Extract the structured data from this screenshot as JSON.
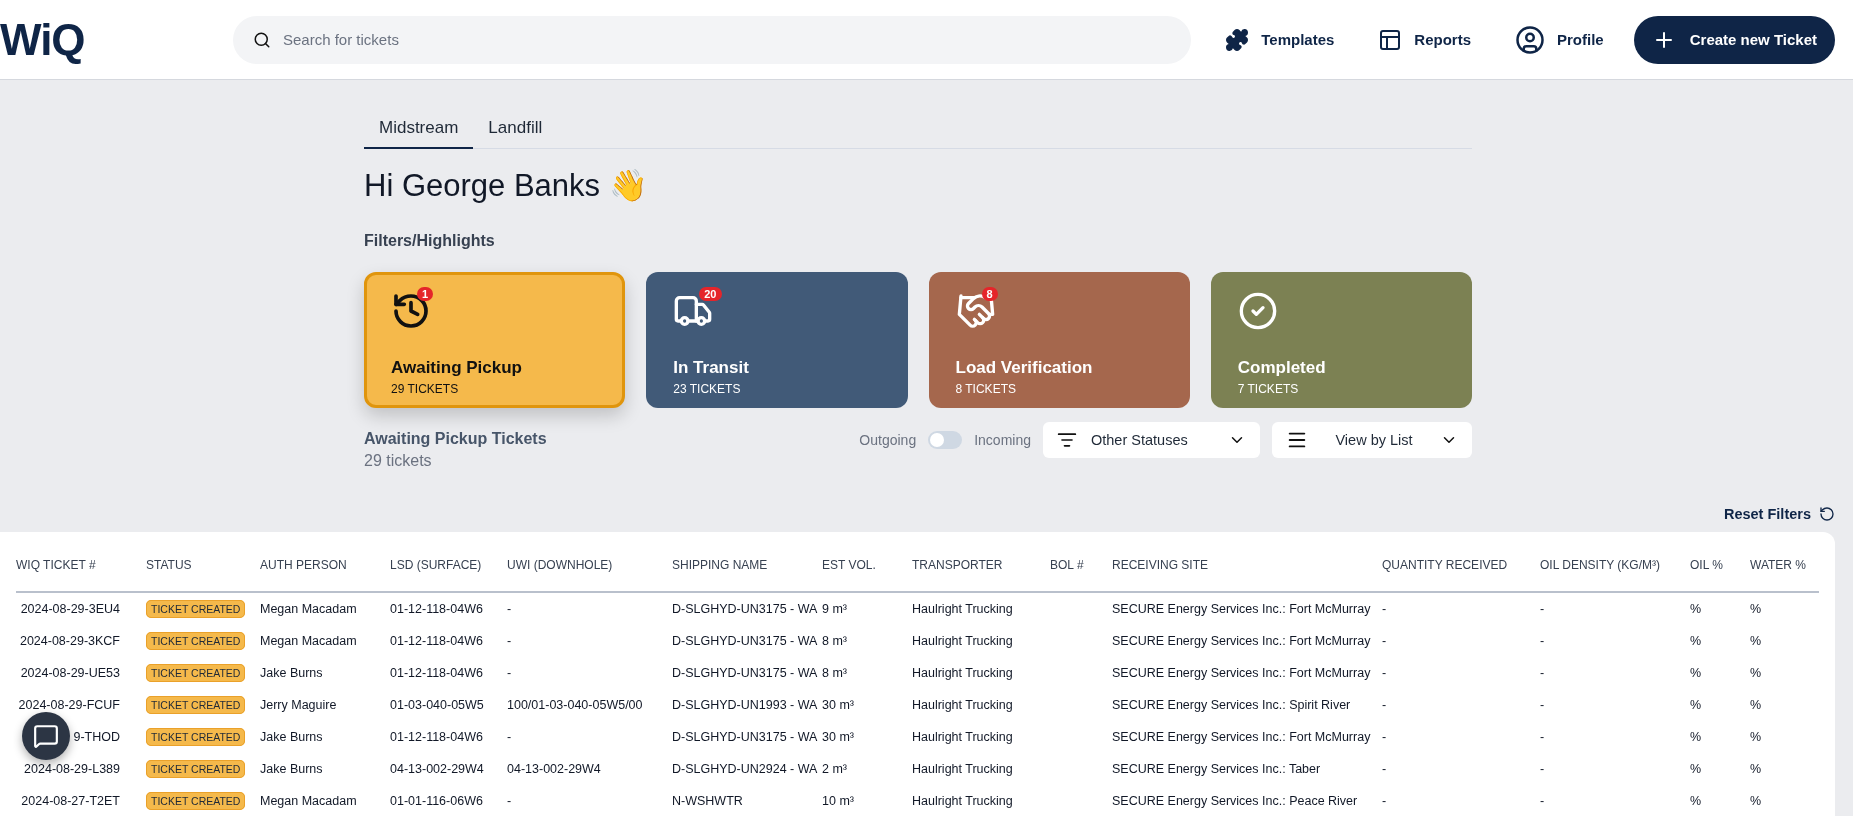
{
  "header": {
    "logo": "WiQ",
    "search": {
      "placeholder": "Search for tickets"
    },
    "nav": [
      {
        "label": "Templates"
      },
      {
        "label": "Reports"
      },
      {
        "label": "Profile"
      }
    ],
    "create_button": "Create new Ticket"
  },
  "tabs": [
    {
      "label": "Midstream",
      "selected": true
    },
    {
      "label": "Landfill",
      "selected": false
    }
  ],
  "greeting": "Hi George Banks 👋",
  "filters_title": "Filters/Highlights",
  "cards": [
    {
      "title": "Awaiting Pickup",
      "count": "29 TICKETS",
      "badge": "1",
      "color": "#f5b94b",
      "selected": true
    },
    {
      "title": "In Transit",
      "count": "23 TICKETS",
      "badge": "20",
      "color": "#415a78",
      "selected": false
    },
    {
      "title": "Load Verification",
      "count": "8 TICKETS",
      "badge": "8",
      "color": "#a5674d",
      "selected": false
    },
    {
      "title": "Completed",
      "count": "7 TICKETS",
      "color": "#7c8153",
      "selected": false
    }
  ],
  "list_title": "Awaiting Pickup Tickets",
  "list_count": "29 tickets",
  "direction": {
    "left": "Outgoing",
    "right": "Incoming",
    "on": false
  },
  "status_filter": "Other Statuses",
  "view_select": "View by List",
  "reset_filters": "Reset Filters",
  "table": {
    "columns": [
      "WIQ TICKET #",
      "STATUS",
      "AUTH PERSON",
      "LSD (SURFACE)",
      "UWI (DOWNHOLE)",
      "SHIPPING NAME",
      "EST VOL.",
      "TRANSPORTER",
      "BOL #",
      "RECEIVING SITE",
      "QUANTITY RECEIVED",
      "OIL DENSITY (KG/M³)",
      "OIL %",
      "WATER %"
    ],
    "rows": [
      [
        "2024-08-29-3EU4",
        "TICKET CREATED",
        "Megan Macadam",
        "01-12-118-04W6",
        "-",
        "D-SLGHYD-UN3175 - WA",
        "9 m³",
        "Haulright Trucking",
        "",
        "SECURE Energy Services Inc.: Fort McMurray",
        "-",
        "-",
        "%",
        "%"
      ],
      [
        "2024-08-29-3KCF",
        "TICKET CREATED",
        "Megan Macadam",
        "01-12-118-04W6",
        "-",
        "D-SLGHYD-UN3175 - WA",
        "8 m³",
        "Haulright Trucking",
        "",
        "SECURE Energy Services Inc.: Fort McMurray",
        "-",
        "-",
        "%",
        "%"
      ],
      [
        "2024-08-29-UE53",
        "TICKET CREATED",
        "Jake Burns",
        "01-12-118-04W6",
        "-",
        "D-SLGHYD-UN3175 - WA",
        "8 m³",
        "Haulright Trucking",
        "",
        "SECURE Energy Services Inc.: Fort McMurray",
        "-",
        "-",
        "%",
        "%"
      ],
      [
        "2024-08-29-FCUF",
        "TICKET CREATED",
        "Jerry Maguire",
        "01-03-040-05W5",
        "100/01-03-040-05W5/00",
        "D-SLGHYD-UN1993 - WA",
        "30 m³",
        "Haulright Trucking",
        "",
        "SECURE Energy Services Inc.: Spirit River",
        "-",
        "-",
        "%",
        "%"
      ],
      [
        "9-THOD",
        "TICKET CREATED",
        "Jake Burns",
        "01-12-118-04W6",
        "-",
        "D-SLGHYD-UN3175 - WA",
        "30 m³",
        "Haulright Trucking",
        "",
        "SECURE Energy Services Inc.: Fort McMurray",
        "-",
        "-",
        "%",
        "%"
      ],
      [
        "2024-08-29-L389",
        "TICKET CREATED",
        "Jake Burns",
        "04-13-002-29W4",
        "04-13-002-29W4",
        "D-SLGHYD-UN2924 - WA",
        "2 m³",
        "Haulright Trucking",
        "",
        "SECURE Energy Services Inc.: Taber",
        "-",
        "-",
        "%",
        "%"
      ],
      [
        "2024-08-27-T2ET",
        "TICKET CREATED",
        "Megan Macadam",
        "01-01-116-06W6",
        "-",
        "N-WSHWTR",
        "10 m³",
        "Haulright Trucking",
        "",
        "SECURE Energy Services Inc.: Peace River",
        "-",
        "-",
        "%",
        "%"
      ]
    ]
  }
}
